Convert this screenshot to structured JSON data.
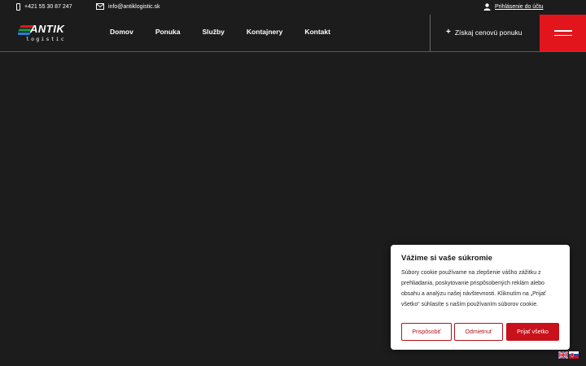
{
  "topbar": {
    "phone": "+421 55 30 87 247",
    "email": "info@antiklogistic.sk",
    "login": "Prihlásenie do účtu"
  },
  "header": {
    "logo_word": "ANTIK",
    "logo_sub": "logistic",
    "nav": [
      "Domov",
      "Ponuka",
      "Služby",
      "Kontajnery",
      "Kontakt"
    ],
    "quote_label": "Získaj cenovú ponuku",
    "quote_icon": "+",
    "menu_icon": "hamburger-icon"
  },
  "colors": {
    "background": "#1c1c1c",
    "accent": "#e3151c",
    "cookie_button": "#c8111a"
  },
  "cookie": {
    "title": "Vážime si vaše súkromie",
    "text": "Súbory cookie používame na zlepšenie vášho zážitku z prehliadania, poskytovanie prispôsobených reklám alebo obsahu a analýzu našej návštevnosti. Kliknutím na „Prijať všetko“ súhlasíte s naším používaním súborov cookie.",
    "btn_customize": "Prispôsobiť",
    "btn_reject": "Odmietnuť",
    "btn_accept": "Prijať všetko"
  },
  "languages": [
    "en-flag-icon",
    "sk-flag-icon"
  ]
}
